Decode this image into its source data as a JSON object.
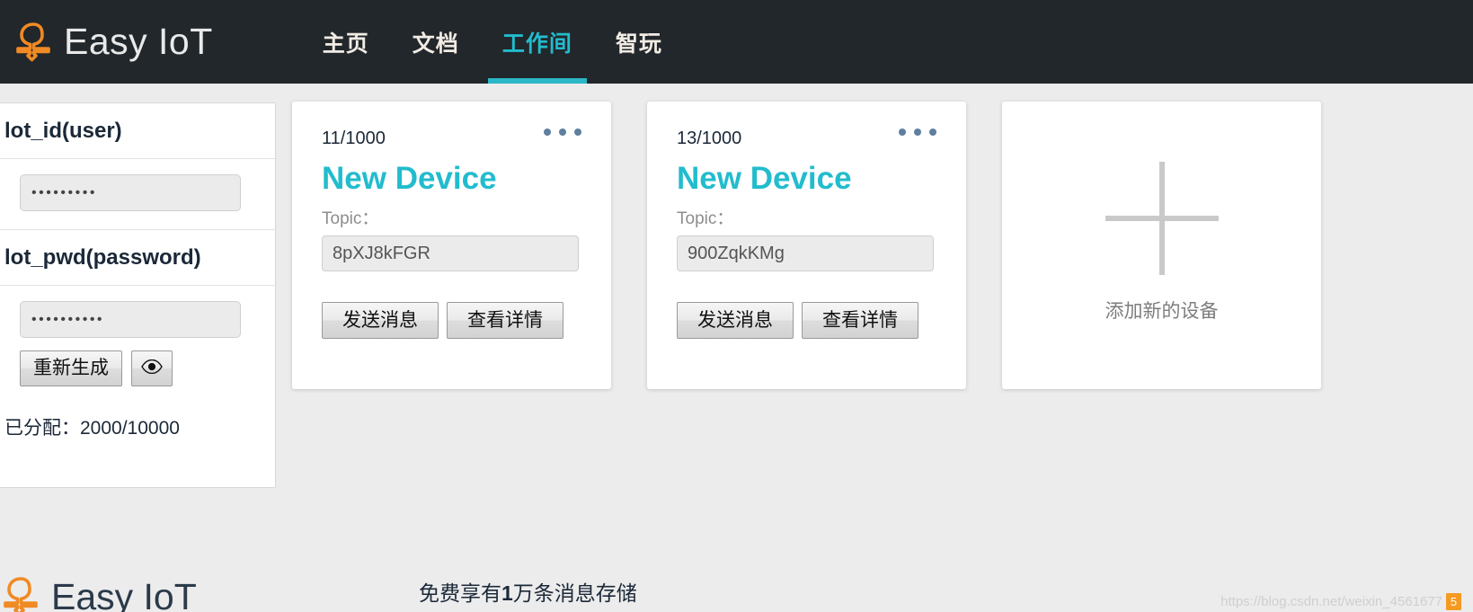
{
  "header": {
    "brand": "Easy IoT",
    "logo_icon": "tree-cloud-icon",
    "nav": [
      {
        "label": "主页",
        "active": false
      },
      {
        "label": "文档",
        "active": false
      },
      {
        "label": "工作间",
        "active": true
      },
      {
        "label": "智玩",
        "active": false
      }
    ],
    "active_color": "#22bccd",
    "background": "#22272b"
  },
  "left_panel": {
    "user_label": "lot_id(user)",
    "user_value": "•••••••••",
    "pwd_label": "lot_pwd(password)",
    "pwd_value": "••••••••••",
    "regenerate_label": "重新生成",
    "toggle_visibility_icon": "eye-icon",
    "quota_text": "已分配：2000/10000"
  },
  "devices": {
    "cards": [
      {
        "count": "11/1000",
        "title": "New Device",
        "topic_label": "Topic：",
        "topic_value": "8pXJ8kFGR",
        "send_label": "发送消息",
        "detail_label": "查看详情",
        "menu_icon": "ellipsis-icon"
      },
      {
        "count": "13/1000",
        "title": "New Device",
        "topic_label": "Topic：",
        "topic_value": "900ZqkKMg",
        "send_label": "发送消息",
        "detail_label": "查看详情",
        "menu_icon": "ellipsis-icon"
      }
    ],
    "add_card": {
      "icon": "plus-icon",
      "label": "添加新的设备"
    }
  },
  "footer": {
    "brand": "Easy IoT",
    "logo_icon": "tree-cloud-icon",
    "note_prefix": "免费享有",
    "note_number": "1",
    "note_suffix": "万条消息存储"
  },
  "watermark": {
    "text": "https://blog.csdn.net/weixin_4561677",
    "badge": "5",
    "badge_color": "#f59a23"
  }
}
